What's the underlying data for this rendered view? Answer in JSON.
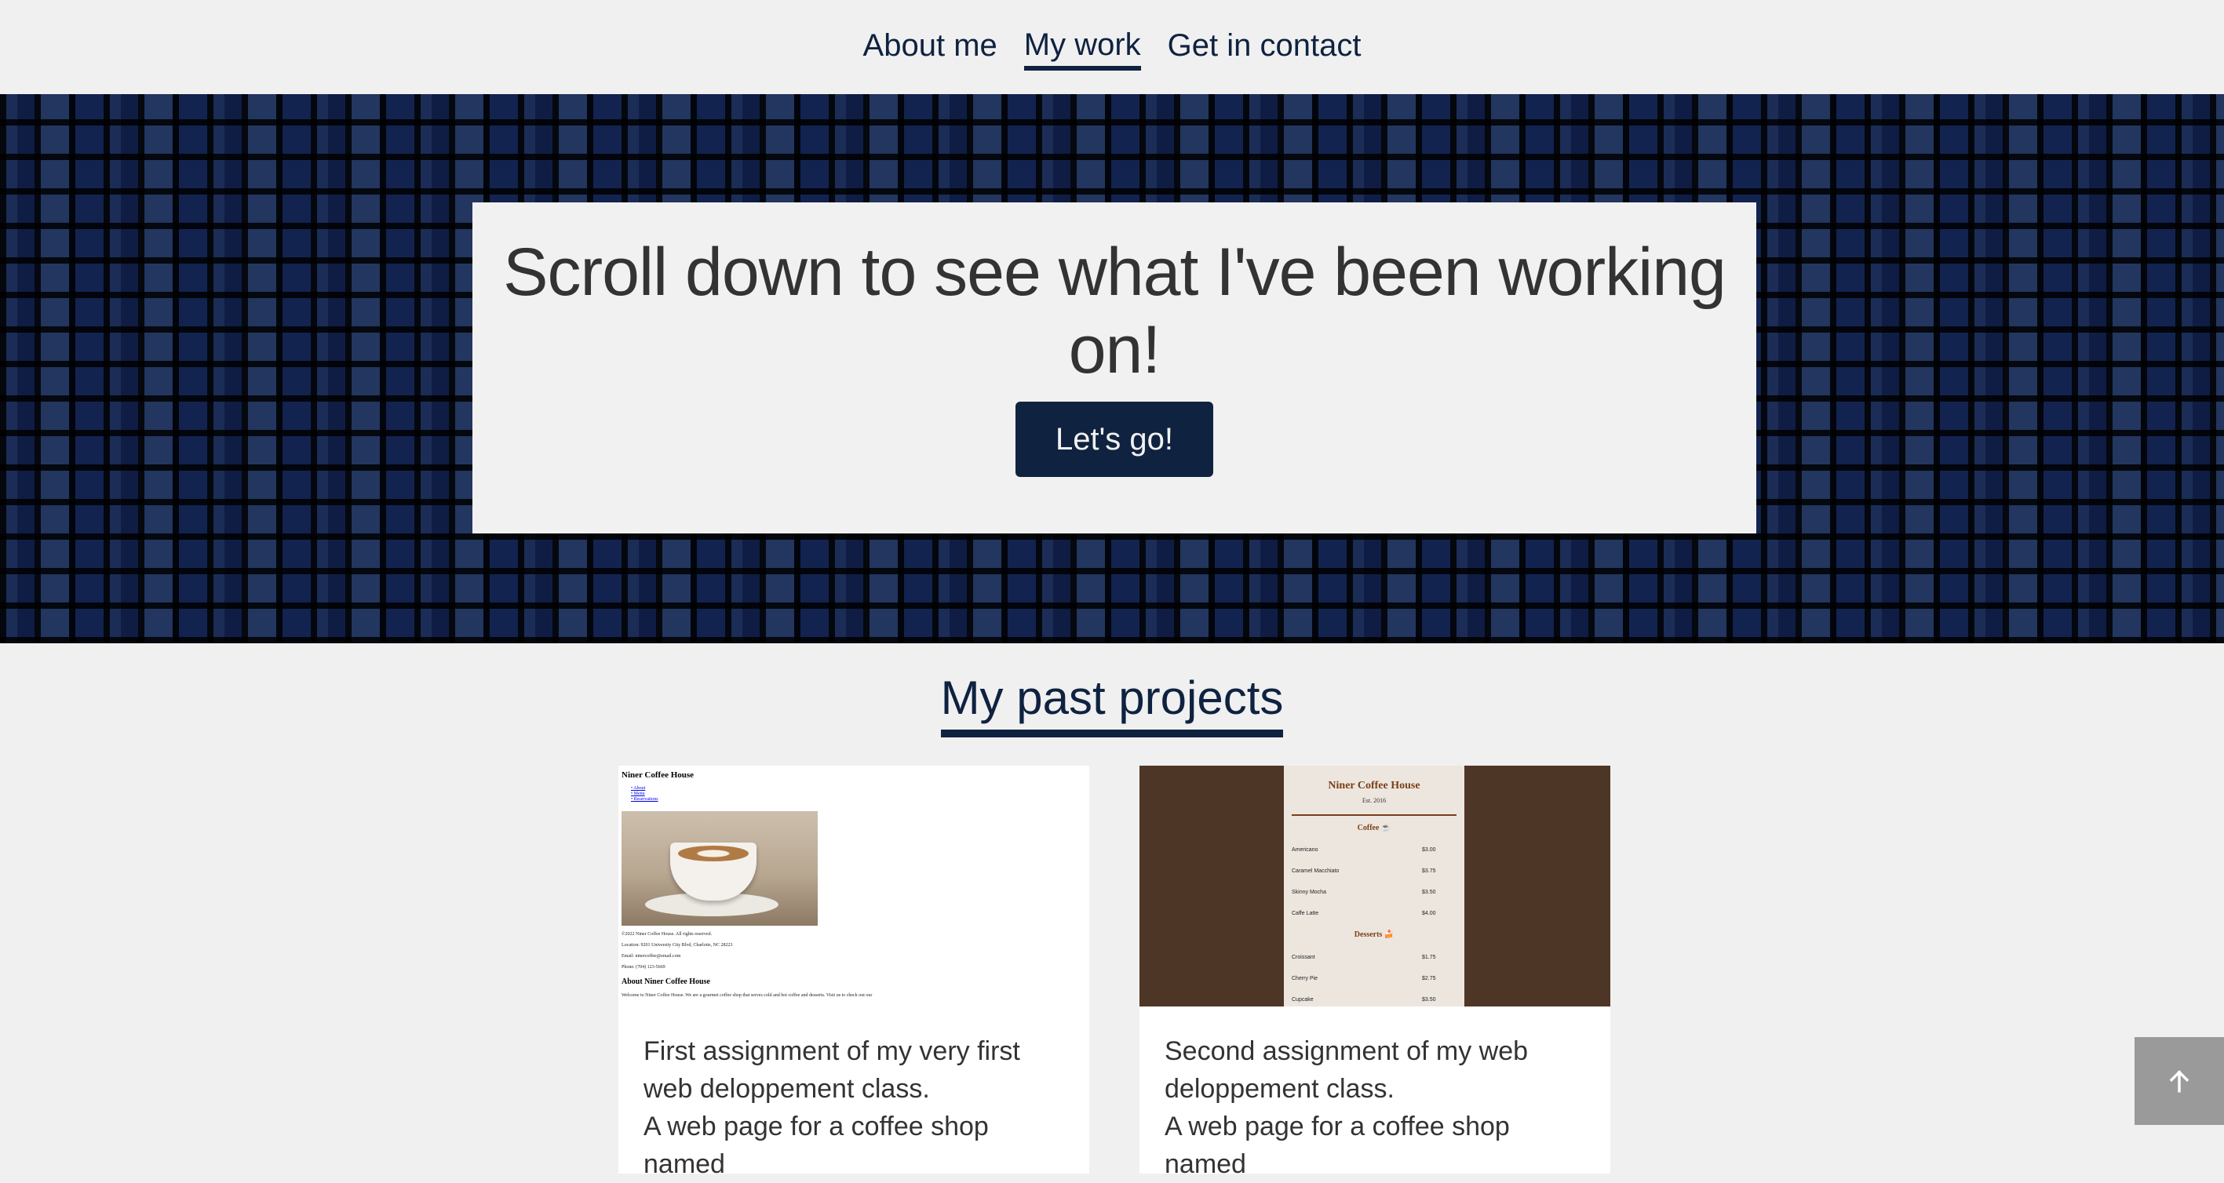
{
  "nav": {
    "items": [
      {
        "label": "About me",
        "active": false
      },
      {
        "label": "My work",
        "active": true
      },
      {
        "label": "Get in contact",
        "active": false
      }
    ]
  },
  "hero": {
    "title": "Scroll down to see what I've been working on!",
    "button_label": "Let's go!"
  },
  "projects": {
    "title": "My past projects",
    "cards": [
      {
        "text_line1": "First assignment of my very first web deloppement class.",
        "text_line2": "A web page for a coffee shop named",
        "thumb": {
          "heading": "Niner Coffee House",
          "links": [
            "About",
            "Menu",
            "Reservations"
          ],
          "copyright": "©2022 Niner Coffee House. All rights reserved.",
          "location": "Location: 9201 University City Blvd, Charlotte, NC 28223",
          "email": "Email: ninercoffee@email.com",
          "phone": "Phone: (704) 123-5669",
          "about_heading": "About Niner Coffee House",
          "about_text": "Welcome to Niner Coffee House. We are a gourmet coffee shop that serves cold and hot coffee and desserts. Visit us to check out our"
        }
      },
      {
        "text_line1": "Second assignment of my web deloppement class.",
        "text_line2": "A web page for a coffee shop named",
        "thumb": {
          "title": "Niner Coffee House",
          "est": "Est. 2016",
          "coffee_heading": "Coffee ☕",
          "coffee_items": [
            {
              "name": "Americano",
              "price": "$3.00"
            },
            {
              "name": "Caramel Macchiato",
              "price": "$3.75"
            },
            {
              "name": "Skinny Mocha",
              "price": "$3.50"
            },
            {
              "name": "Caffe Latte",
              "price": "$4.00"
            }
          ],
          "desserts_heading": "Desserts 🍰",
          "dessert_items": [
            {
              "name": "Croissant",
              "price": "$1.75"
            },
            {
              "name": "Cherry Pie",
              "price": "$2.75"
            },
            {
              "name": "Cupcake",
              "price": "$3.50"
            }
          ]
        }
      }
    ]
  },
  "back_to_top": {
    "icon": "arrow-up-icon",
    "symbol": "↑"
  }
}
